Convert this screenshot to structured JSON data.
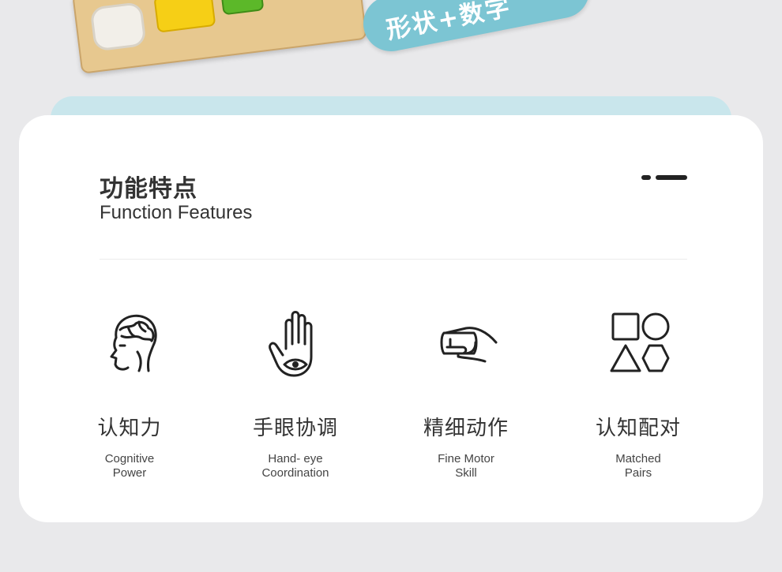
{
  "product_photo": {
    "tag_text": "形状+数字"
  },
  "section": {
    "title_cn": "功能特点",
    "title_en": "Function Features"
  },
  "features": [
    {
      "icon": "brain-head-icon",
      "label_cn": "认知力",
      "label_en": "Cognitive\nPower"
    },
    {
      "icon": "hand-eye-icon",
      "label_cn": "手眼协调",
      "label_en": "Hand- eye\nCoordination"
    },
    {
      "icon": "hand-grip-icon",
      "label_cn": "精细动作",
      "label_en": "Fine Motor\nSkill"
    },
    {
      "icon": "shapes-icon",
      "label_cn": "认知配对",
      "label_en": "Matched\nPairs"
    }
  ],
  "colors": {
    "page_bg": "#e9e9eb",
    "card_bg": "#ffffff",
    "card_strip": "#c9e6ec",
    "tag_pill": "#7cc5d3",
    "text_dark": "#333333"
  }
}
